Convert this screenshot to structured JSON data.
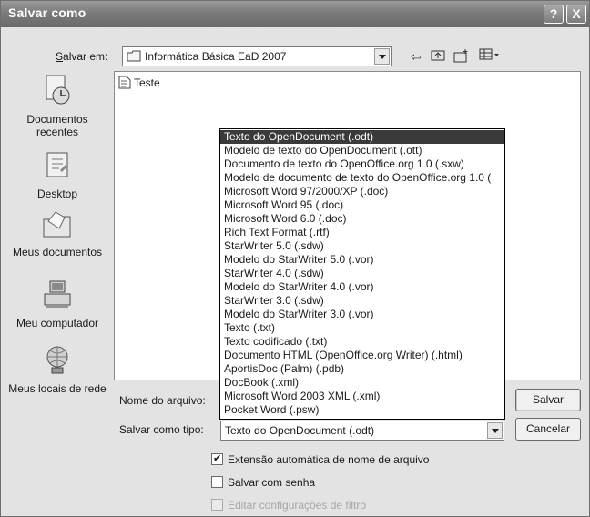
{
  "title": "Salvar como",
  "titlebar_buttons": {
    "help": "?",
    "close": "X"
  },
  "save_in": {
    "label": "Salvar em:",
    "value": "Informática Básica EaD 2007",
    "icons": [
      "back-arrow-icon",
      "up-folder-icon",
      "new-folder-icon",
      "view-menu-icon"
    ]
  },
  "places": [
    {
      "label": "Documentos recentes",
      "icon": "recent-documents-icon"
    },
    {
      "label": "Desktop",
      "icon": "desktop-icon"
    },
    {
      "label": "Meus documentos",
      "icon": "my-documents-icon"
    },
    {
      "label": "Meu computador",
      "icon": "my-computer-icon"
    },
    {
      "label": "Meus locais de rede",
      "icon": "network-places-icon"
    }
  ],
  "files": [
    {
      "name": "Teste",
      "icon": "document-icon"
    }
  ],
  "file_name": {
    "label": "Nome do arquivo:",
    "value": ""
  },
  "file_type": {
    "label": "Salvar como tipo:",
    "value": "Texto do OpenDocument (.odt)",
    "options": [
      "Texto do OpenDocument (.odt)",
      "Modelo de texto do OpenDocument (.ott)",
      "Documento de texto do OpenOffice.org 1.0 (.sxw)",
      "Modelo de documento de texto do OpenOffice.org 1.0 (",
      "Microsoft Word 97/2000/XP (.doc)",
      "Microsoft Word 95 (.doc)",
      "Microsoft Word 6.0 (.doc)",
      "Rich Text Format (.rtf)",
      "StarWriter 5.0 (.sdw)",
      "Modelo do StarWriter 5.0 (.vor)",
      "StarWriter 4.0 (.sdw)",
      "Modelo do StarWriter 4.0 (.vor)",
      "StarWriter 3.0 (.sdw)",
      "Modelo do StarWriter 3.0 (.vor)",
      "Texto (.txt)",
      "Texto codificado (.txt)",
      "Documento HTML (OpenOffice.org Writer) (.html)",
      "AportisDoc (Palm) (.pdb)",
      "DocBook (.xml)",
      "Microsoft Word 2003 XML (.xml)",
      "Pocket Word (.psw)"
    ],
    "selected_index": 0
  },
  "buttons": {
    "save": "Salvar",
    "cancel": "Cancelar"
  },
  "options": [
    {
      "label": "Extensão automática de nome de arquivo",
      "checked": true,
      "enabled": true
    },
    {
      "label": "Salvar com senha",
      "checked": false,
      "enabled": true
    },
    {
      "label": "Editar configurações de filtro",
      "checked": false,
      "enabled": false
    }
  ],
  "colors": {
    "titlebar": "#7b7b7b",
    "selection": "#3a3a3a",
    "window": "#e3e3e3"
  }
}
